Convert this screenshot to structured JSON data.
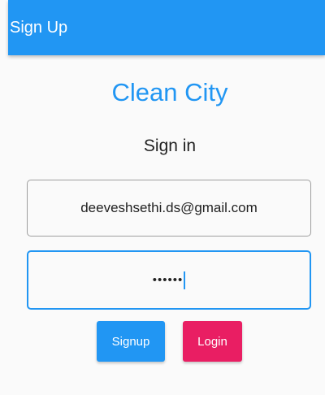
{
  "appbar": {
    "title": "Sign Up"
  },
  "brand": {
    "name": "Clean City"
  },
  "form": {
    "heading": "Sign in",
    "email_value": "deeveshsethi.ds@gmail.com",
    "password_mask": "••••••"
  },
  "buttons": {
    "signup_label": "Signup",
    "login_label": "Login"
  },
  "colors": {
    "primary": "#2196f3",
    "accent": "#e91e63",
    "field_border": "#9e9e9e"
  }
}
